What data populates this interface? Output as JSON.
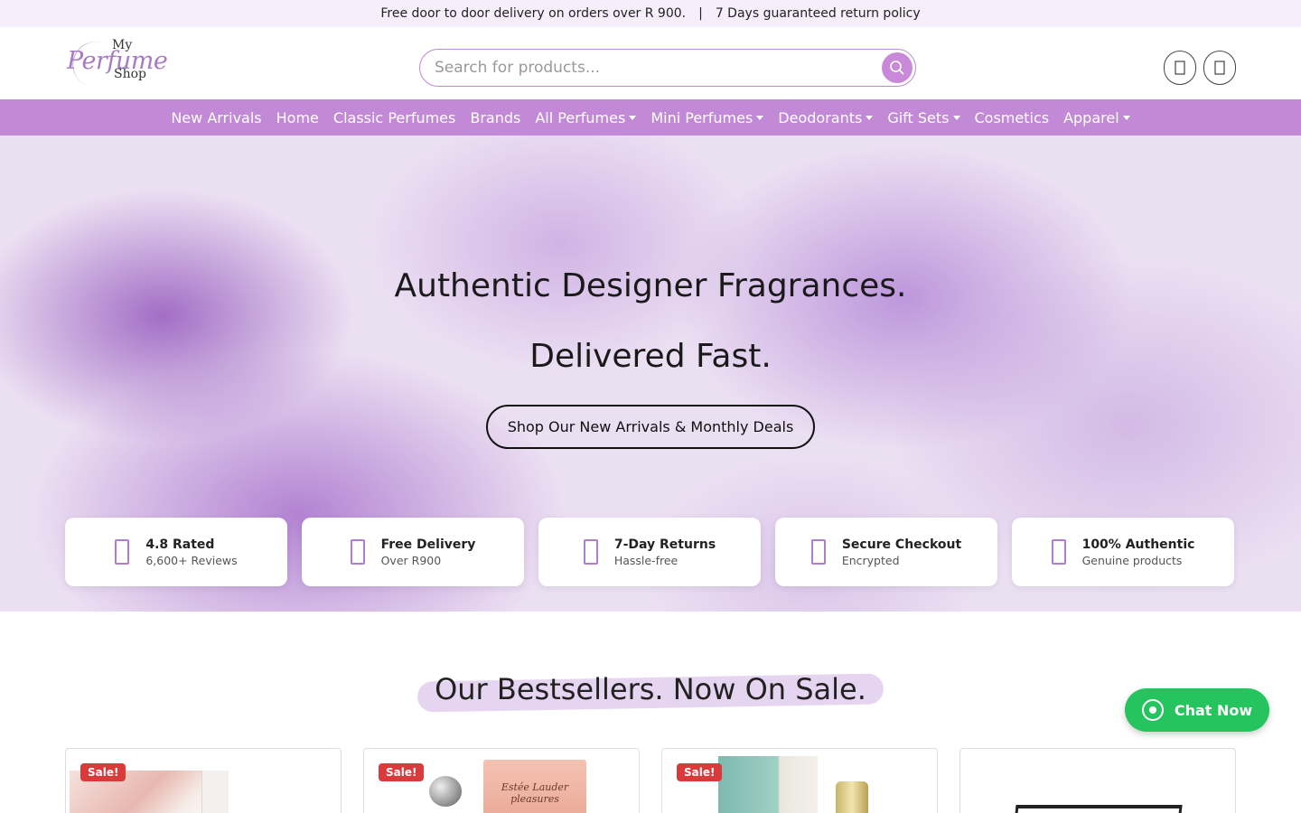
{
  "topbar": {
    "delivery": "Free door to door delivery on orders over R 900.",
    "separator": "|",
    "returns": "7 Days guaranteed return policy"
  },
  "logo": {
    "my": "My",
    "perfume": "Perfume",
    "shop": "Shop"
  },
  "search": {
    "placeholder": "Search for products..."
  },
  "header_icons": [
    "user-icon",
    "cart-icon"
  ],
  "nav": {
    "items": [
      {
        "label": "New Arrivals",
        "dropdown": false
      },
      {
        "label": "Home",
        "dropdown": false
      },
      {
        "label": "Classic Perfumes",
        "dropdown": false
      },
      {
        "label": "Brands",
        "dropdown": false
      },
      {
        "label": "All Perfumes",
        "dropdown": true
      },
      {
        "label": "Mini Perfumes",
        "dropdown": true
      },
      {
        "label": "Deodorants",
        "dropdown": true
      },
      {
        "label": "Gift Sets",
        "dropdown": true
      },
      {
        "label": "Cosmetics",
        "dropdown": false
      },
      {
        "label": "Apparel",
        "dropdown": true
      }
    ]
  },
  "hero": {
    "line1": "Authentic Designer Fragrances.",
    "line2": "Delivered Fast.",
    "cta": "Shop Our New Arrivals & Monthly Deals"
  },
  "features": [
    {
      "title": "4.8 Rated",
      "subtitle": "6,600+ Reviews",
      "icon": "star-icon"
    },
    {
      "title": "Free Delivery",
      "subtitle": "Over R900",
      "icon": "truck-icon"
    },
    {
      "title": "7-Day Returns",
      "subtitle": "Hassle-free",
      "icon": "return-icon"
    },
    {
      "title": "Secure Checkout",
      "subtitle": "Encrypted",
      "icon": "lock-icon"
    },
    {
      "title": "100% Authentic",
      "subtitle": "Genuine products",
      "icon": "shield-check-icon"
    }
  ],
  "bestsellers": {
    "title": "Our Bestsellers. Now On Sale.",
    "badge": "Sale!",
    "products": [
      {
        "sale": true
      },
      {
        "sale": true,
        "brand_text": "Estée Lauder pleasures"
      },
      {
        "sale": true
      },
      {
        "sale": false
      }
    ]
  },
  "chat": {
    "label": "Chat Now"
  },
  "colors": {
    "accent": "#c28ad6",
    "topbar_bg": "#f6eefa",
    "sale": "#d93a3a",
    "chat": "#25c45e"
  }
}
